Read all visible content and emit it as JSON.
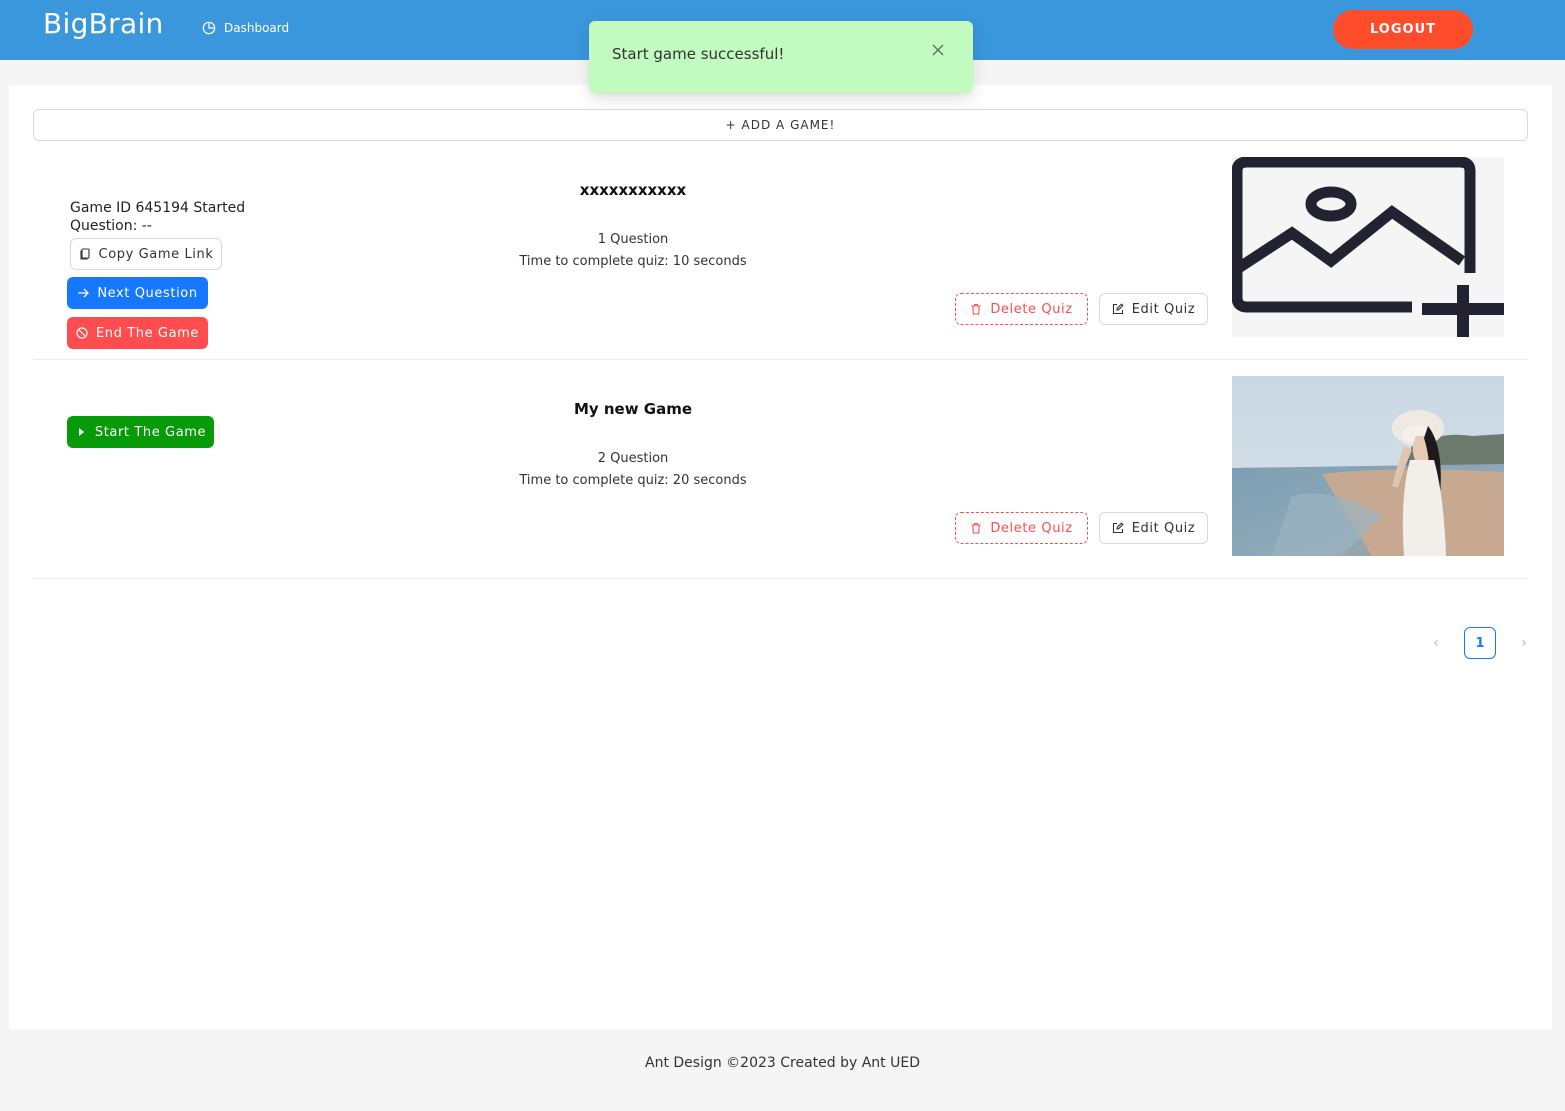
{
  "header": {
    "logo": "BigBrain",
    "nav": {
      "dashboard_label": "Dashboard"
    },
    "logout_label": "LOGOUT"
  },
  "toast": {
    "message": "Start game successful!"
  },
  "main": {
    "add_game_label": "+ ADD A GAME!",
    "games": [
      {
        "status_line1": "Game ID 645194 Started",
        "status_line2": "Question: --",
        "copy_link_label": "Copy Game Link",
        "next_question_label": "Next Question",
        "end_game_label": "End The Game",
        "title": "xxxxxxxxxxx",
        "questions": "1 Question",
        "time": "Time to complete quiz: 10 seconds",
        "delete_label": "Delete Quiz",
        "edit_label": "Edit Quiz",
        "thumbnail": "image-add-placeholder-icon"
      },
      {
        "start_game_label": "Start The Game",
        "title": "My new Game",
        "questions": "2 Question",
        "time": "Time to complete quiz: 20 seconds",
        "delete_label": "Delete Quiz",
        "edit_label": "Edit Quiz",
        "thumbnail": "beach-photo"
      }
    ]
  },
  "pagination": {
    "current_page": "1"
  },
  "footer": {
    "text": "Ant Design ©2023 Created by Ant UED"
  },
  "colors": {
    "header_bg": "#3a97dc",
    "logout": "#ff4d2b",
    "toast_bg": "#c2fbc0",
    "primary": "#1677ff",
    "danger": "#ff4d4f",
    "success": "#079b09"
  }
}
